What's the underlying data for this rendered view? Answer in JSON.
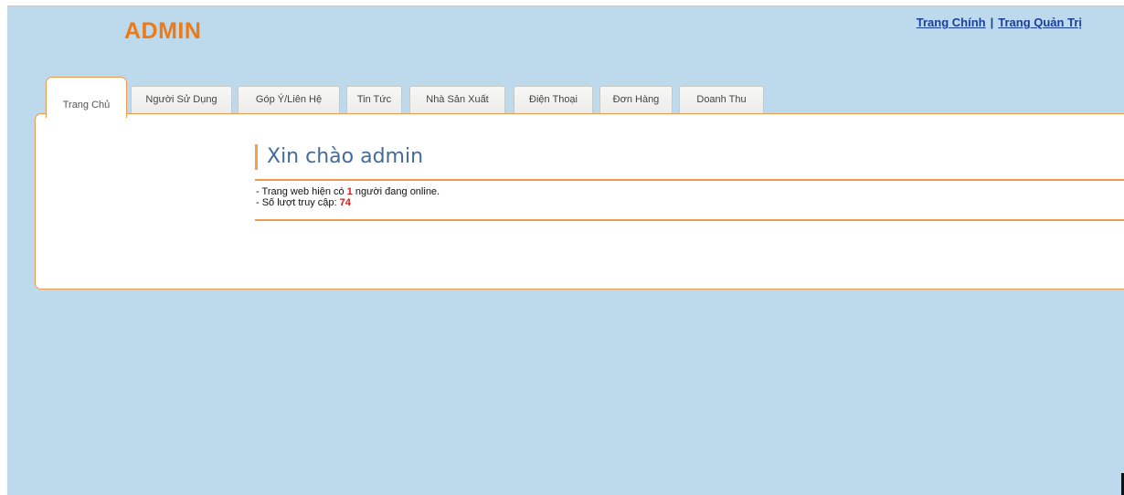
{
  "header": {
    "brand": "ADMIN",
    "links": {
      "home": "Trang Chính",
      "separator": "|",
      "admin": "Trang Quản Trị"
    }
  },
  "tabs": [
    {
      "label": "Trang Chủ",
      "active": true
    },
    {
      "label": "Người Sử Dụng",
      "active": false
    },
    {
      "label": "Góp Ý/Liên Hệ",
      "active": false
    },
    {
      "label": "Tin Tức",
      "active": false
    },
    {
      "label": "Nhà Sản Xuất",
      "active": false
    },
    {
      "label": "Điện Thoại",
      "active": false
    },
    {
      "label": "Đơn Hàng",
      "active": false
    },
    {
      "label": "Doanh Thu",
      "active": false
    }
  ],
  "main": {
    "title": "Xin chào admin",
    "online": {
      "prefix": "- Trang web hiện có ",
      "count": "1",
      "suffix": " người đang online."
    },
    "visits": {
      "prefix": "- Số lượt truy cập: ",
      "count": "74"
    }
  },
  "colors": {
    "background": "#bdd9ec",
    "accent": "#ee7a17",
    "border": "#ee9a50",
    "title": "#456b96",
    "link": "#1a3f9c",
    "highlight": "#d11a1a"
  }
}
